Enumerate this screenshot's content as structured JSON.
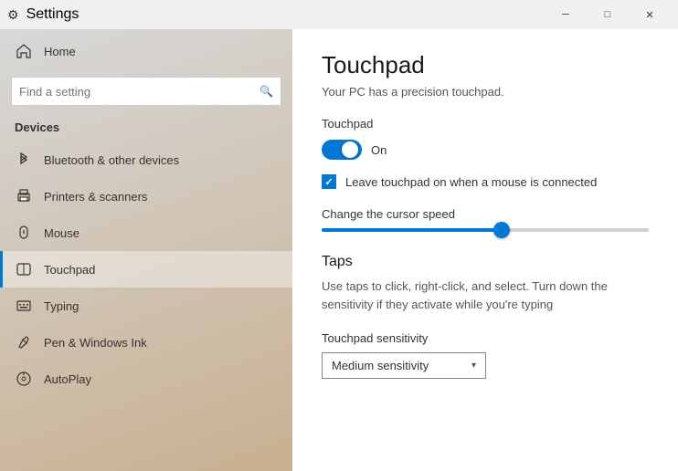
{
  "titlebar": {
    "title": "Settings",
    "back_label": "←",
    "minimize_label": "─",
    "maximize_label": "□",
    "close_label": "✕"
  },
  "sidebar": {
    "search_placeholder": "Find a setting",
    "section_title": "Devices",
    "items": [
      {
        "id": "bluetooth",
        "label": "Bluetooth & other devices",
        "icon": "bluetooth"
      },
      {
        "id": "printers",
        "label": "Printers & scanners",
        "icon": "printer"
      },
      {
        "id": "mouse",
        "label": "Mouse",
        "icon": "mouse"
      },
      {
        "id": "touchpad",
        "label": "Touchpad",
        "icon": "touchpad",
        "active": true
      },
      {
        "id": "typing",
        "label": "Typing",
        "icon": "typing"
      },
      {
        "id": "pen",
        "label": "Pen & Windows Ink",
        "icon": "pen"
      },
      {
        "id": "autoplay",
        "label": "AutoPlay",
        "icon": "autoplay"
      }
    ]
  },
  "home": {
    "label": "Home"
  },
  "content": {
    "title": "Touchpad",
    "subtitle": "Your PC has a precision touchpad.",
    "touchpad_section_label": "Touchpad",
    "toggle_label": "On",
    "checkbox_label": "Leave touchpad on when a mouse is connected",
    "slider_label": "Change the cursor speed",
    "slider_percent": 55,
    "taps_title": "Taps",
    "taps_desc": "Use taps to click, right-click, and select. Turn down the sensitivity if they activate while you're typing",
    "sensitivity_label": "Touchpad sensitivity",
    "sensitivity_value": "Medium sensitivity"
  }
}
